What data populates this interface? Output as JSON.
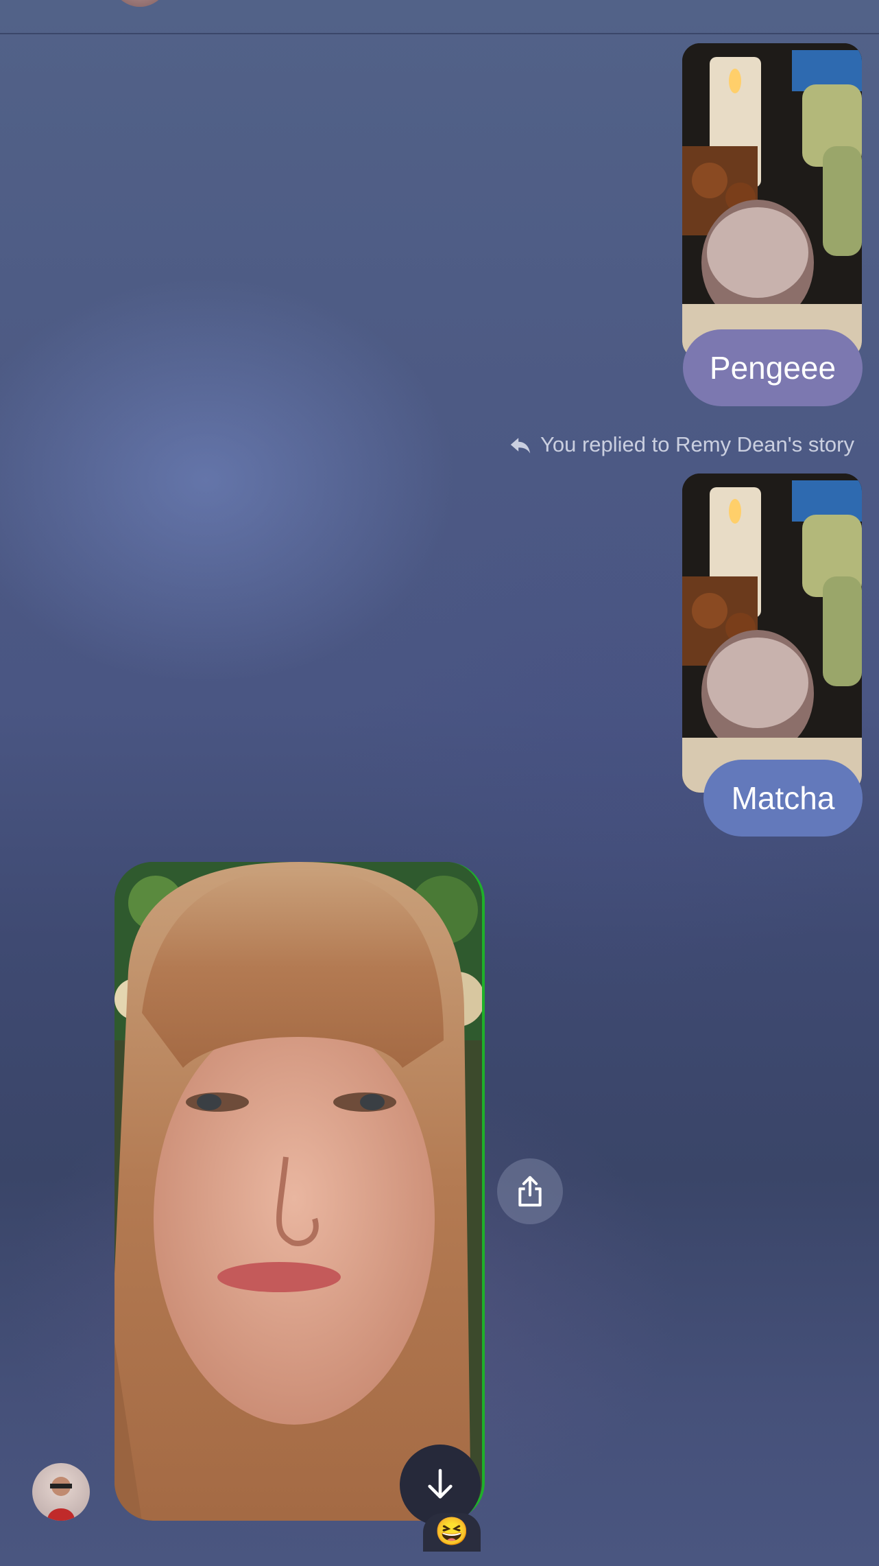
{
  "messages": [
    {
      "type": "story_reply_image",
      "caption": "Pengeee"
    },
    {
      "type": "system_note",
      "text": "You replied to Remy Dean's story"
    },
    {
      "type": "story_reply_image",
      "caption": "Matcha"
    },
    {
      "type": "received_photo",
      "reaction": "😆"
    }
  ],
  "colors": {
    "bubble_purple": "#7c78b0",
    "bubble_blue": "#6379bb",
    "download_button": "#26293a"
  },
  "icons": {
    "reply": "reply-arrow-icon",
    "share": "share-icon",
    "download": "arrow-down-icon"
  }
}
